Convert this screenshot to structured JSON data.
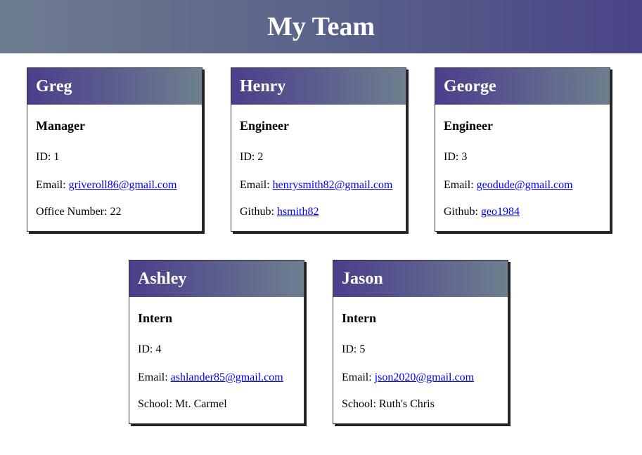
{
  "header": {
    "title": "My Team"
  },
  "cards": [
    {
      "name": "Greg",
      "role": "Manager",
      "id_label": "ID:",
      "id": "1",
      "email_label": "Email:",
      "email": "griveroll86@gmail.com",
      "extra_label": "Office Number:",
      "extra": "22",
      "extra_is_link": false
    },
    {
      "name": "Henry",
      "role": "Engineer",
      "id_label": "ID:",
      "id": "2",
      "email_label": "Email:",
      "email": "henrysmith82@gmail.com",
      "extra_label": "Github:",
      "extra": "hsmith82",
      "extra_is_link": true
    },
    {
      "name": "George",
      "role": "Engineer",
      "id_label": "ID:",
      "id": "3",
      "email_label": "Email:",
      "email": "geodude@gmail.com",
      "extra_label": "Github:",
      "extra": "geo1984",
      "extra_is_link": true
    },
    {
      "name": "Ashley",
      "role": "Intern",
      "id_label": "ID:",
      "id": "4",
      "email_label": "Email:",
      "email": "ashlander85@gmail.com",
      "extra_label": "School:",
      "extra": "Mt. Carmel",
      "extra_is_link": false
    },
    {
      "name": "Jason",
      "role": "Intern",
      "id_label": "ID:",
      "id": "5",
      "email_label": "Email:",
      "email": "json2020@gmail.com",
      "extra_label": "School:",
      "extra": "Ruth's Chris",
      "extra_is_link": false
    }
  ],
  "colors": {
    "header_gradient": [
      "#6e7c8f",
      "#4a4488"
    ],
    "card_header_gradient": [
      "#4a3f8c",
      "#6e7f8e"
    ],
    "link": "#0000ee"
  }
}
